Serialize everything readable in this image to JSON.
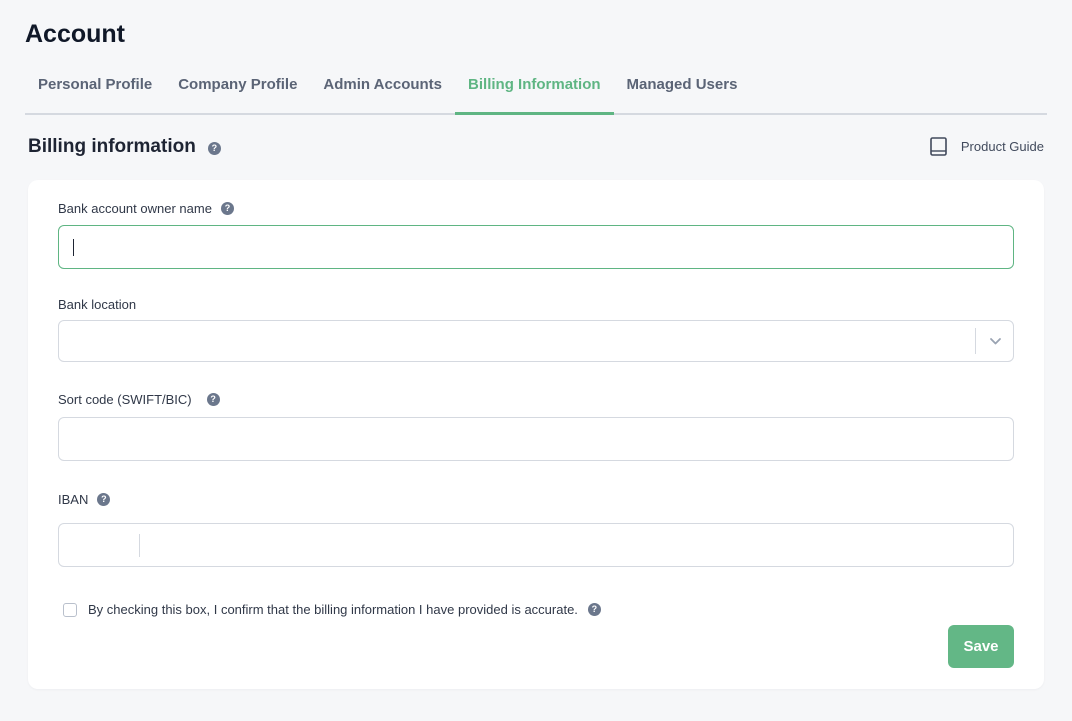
{
  "page": {
    "title": "Account"
  },
  "tabs": [
    {
      "label": "Personal Profile",
      "active": false
    },
    {
      "label": "Company Profile",
      "active": false
    },
    {
      "label": "Admin Accounts",
      "active": false
    },
    {
      "label": "Billing Information",
      "active": true
    },
    {
      "label": "Managed Users",
      "active": false
    }
  ],
  "section": {
    "title": "Billing information",
    "help_icon": "question-circle-icon",
    "product_guide_label": "Product Guide",
    "product_guide_icon": "book-icon"
  },
  "form": {
    "owner_name": {
      "label": "Bank account owner name",
      "value": "",
      "focused": true
    },
    "bank_location": {
      "label": "Bank location",
      "value": "",
      "dropdown_icon": "chevron-down-icon"
    },
    "sort_code": {
      "label": "Sort code (SWIFT/BIC)",
      "value": ""
    },
    "iban": {
      "label": "IBAN",
      "country_value": "",
      "value": ""
    },
    "confirm": {
      "label": "By checking this box, I confirm that the billing information I have provided is accurate.",
      "checked": false
    },
    "save_label": "Save"
  },
  "colors": {
    "accent": "#5fb583",
    "save_button": "#63b786",
    "help_icon": "#6b778c",
    "background": "#f6f7f9"
  }
}
